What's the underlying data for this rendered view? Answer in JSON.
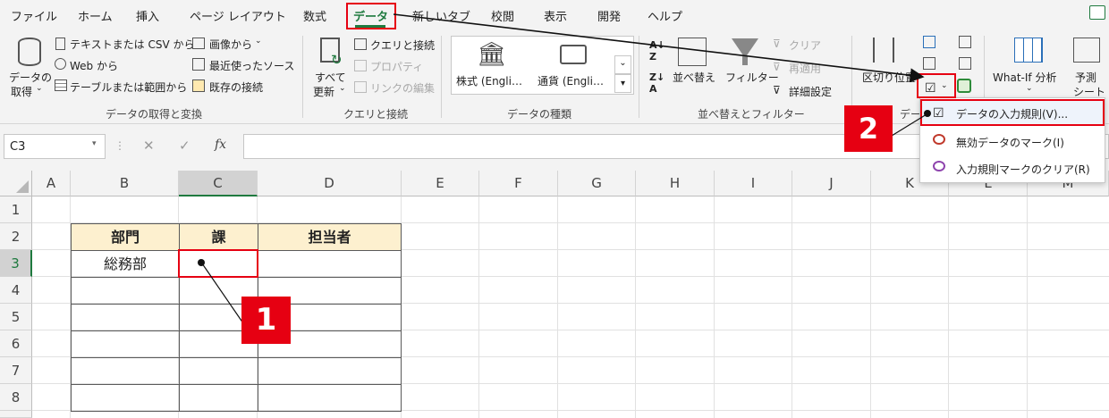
{
  "menubar": {
    "tabs": [
      "ファイル",
      "ホーム",
      "挿入",
      "ページ レイアウト",
      "数式",
      "データ",
      "新しいタブ",
      "校閲",
      "表示",
      "開発",
      "ヘルプ"
    ],
    "active": "データ"
  },
  "ribbon": {
    "get_data": {
      "label_line1": "データの",
      "label_line2": "取得",
      "from_text_csv": "テキストまたは CSV から",
      "from_web": "Web から",
      "from_table": "テーブルまたは範囲から",
      "from_image": "画像から",
      "recent_sources": "最近使ったソース",
      "existing_connections": "既存の接続",
      "group_label": "データの取得と変換"
    },
    "queries": {
      "refresh_line1": "すべて",
      "refresh_line2": "更新",
      "queries_connections": "クエリと接続",
      "properties": "プロパティ",
      "edit_links": "リンクの編集",
      "group_label": "クエリと接続"
    },
    "data_types": {
      "stocks": "株式 (Engli…",
      "currencies": "通貨 (Engli…",
      "group_label": "データの種類"
    },
    "sort_filter": {
      "sort": "並べ替え",
      "filter": "フィルター",
      "clear": "クリア",
      "reapply": "再適用",
      "advanced": "詳細設定",
      "group_label": "並べ替えとフィルター"
    },
    "data_tools": {
      "text_to_columns": "区切り位置",
      "group_label_partial": "データ"
    },
    "forecast": {
      "whatif": "What-If 分析",
      "forecast_line1": "予測",
      "forecast_line2": "シート"
    }
  },
  "formula_bar": {
    "name_box": "C3",
    "fx": "fx",
    "value": ""
  },
  "grid": {
    "columns": [
      "A",
      "B",
      "C",
      "D",
      "E",
      "F",
      "G",
      "H",
      "I",
      "J",
      "K",
      "L",
      "M"
    ],
    "rows": [
      "1",
      "2",
      "3",
      "4",
      "5",
      "6",
      "7",
      "8"
    ],
    "table_headers": [
      "部門",
      "課",
      "担当者"
    ],
    "b3": "総務部"
  },
  "dropdown": {
    "items": [
      "データの入力規則(V)...",
      "無効データのマーク(I)",
      "入力規則マークのクリア(R)"
    ]
  },
  "annotations": {
    "badge1": "1",
    "badge2": "2"
  },
  "colors": {
    "accent_green": "#1f7a3f",
    "highlight_red": "#e60012",
    "header_fill": "#fdf0cf"
  }
}
